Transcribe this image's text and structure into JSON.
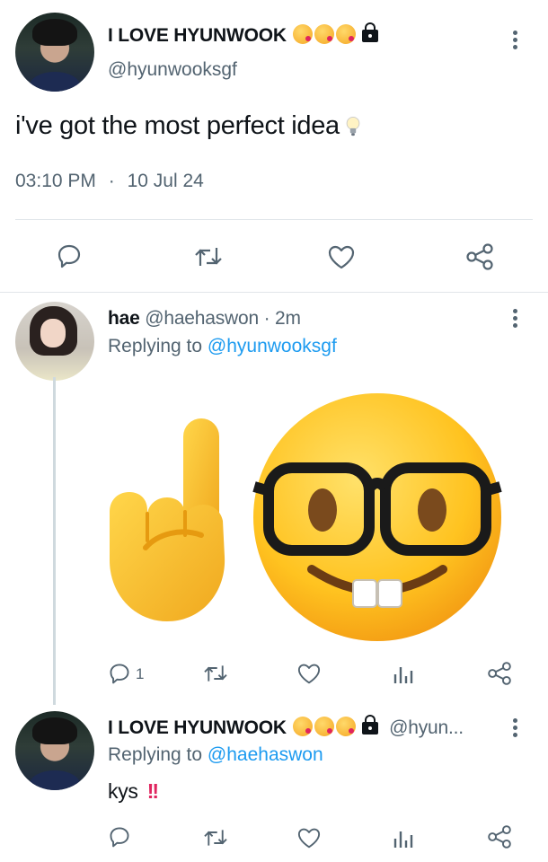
{
  "main_tweet": {
    "display_name": "I LOVE HYUNWOOK",
    "handle": "@hyunwooksgf",
    "text": "i've got the most perfect idea",
    "time": "03:10 PM",
    "separator": "·",
    "date": "10 Jul 24",
    "emoji_icons": [
      "kissing-face-icon",
      "kissing-face-icon",
      "kissing-face-icon",
      "lock-icon",
      "light-bulb-icon"
    ]
  },
  "reply1": {
    "display_name": "hae",
    "handle": "@haehaswon",
    "time": "· 2m",
    "replying_prefix": "Replying to",
    "replying_to": "@hyunwooksgf",
    "emoji_icons": [
      "index-pointing-up-icon",
      "nerd-face-icon"
    ],
    "reply_count": "1"
  },
  "reply2": {
    "display_name": "I LOVE HYUNWOOK",
    "handle": "@hyun...",
    "replying_prefix": "Replying to",
    "replying_to": "@haehaswon",
    "text": "kys",
    "emoji_icons": [
      "kissing-face-icon",
      "kissing-face-icon",
      "kissing-face-icon",
      "lock-icon",
      "double-exclamation-icon"
    ]
  },
  "actions": [
    "reply-icon",
    "retweet-icon",
    "like-icon",
    "views-icon",
    "share-icon"
  ],
  "colors": {
    "link": "#1d9bf0",
    "muted": "#536471",
    "divider": "#e1e6ea",
    "text": "#0f1419"
  }
}
